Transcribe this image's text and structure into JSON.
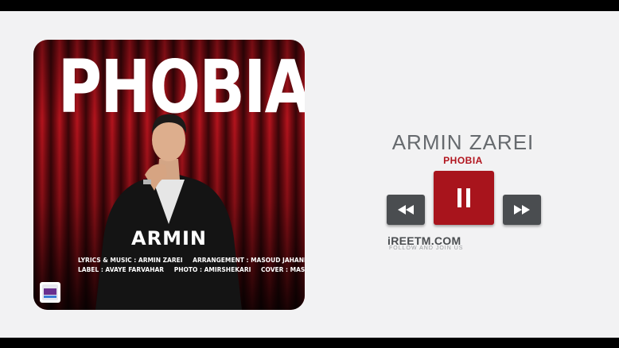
{
  "album": {
    "title": "PHOBIA",
    "artist": "ARMIN",
    "credits_line1": [
      "LYRICS & MUSIC : ARMIN ZAREI",
      "ARRANGEMENT : MASOUD JAHANI | REZBEAT"
    ],
    "credits_line2": [
      "LABEL : AVAYE FARVAHAR",
      "PHOTO : AMIRSHEKARI",
      "COVER : MASOOD ZAKERI"
    ]
  },
  "player": {
    "artist_name": "ARMIN ZAREI",
    "song_title": "PHOBIA",
    "icons": {
      "previous": "rewind-icon",
      "pause": "pause-icon",
      "next": "fast-forward-icon"
    }
  },
  "footer": {
    "site": "iREETM.COM",
    "tagline": "FOLLOW AND JOIN US"
  },
  "colors": {
    "accent": "#a8141c",
    "control": "#4a4d50",
    "background": "#f2f2f3",
    "artist_text": "#666a6e"
  }
}
